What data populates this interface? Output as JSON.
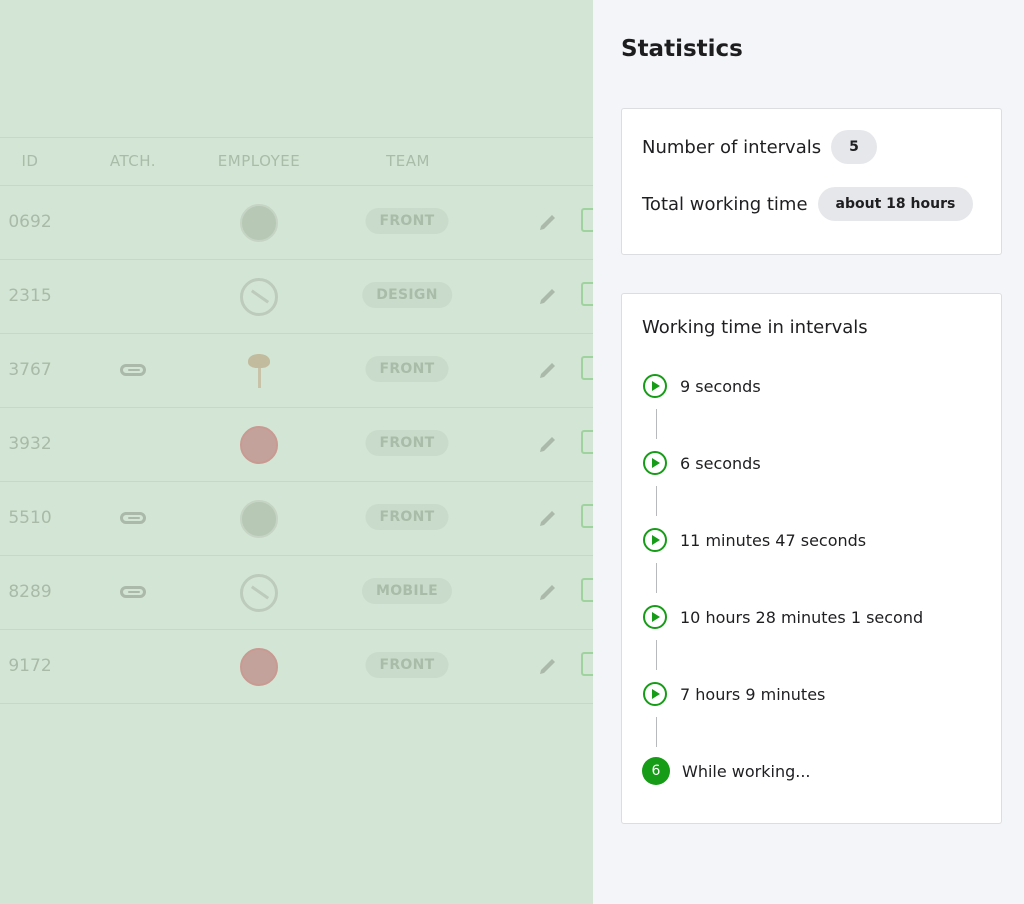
{
  "table": {
    "headers": [
      "ID",
      "ATCH.",
      "EMPLOYEE",
      "TEAM"
    ],
    "rows": [
      {
        "id": "0692",
        "attachment": false,
        "avatar": "photo",
        "team": "FRONT"
      },
      {
        "id": "2315",
        "attachment": false,
        "avatar": "no-image",
        "team": "DESIGN"
      },
      {
        "id": "3767",
        "attachment": true,
        "avatar": "pin",
        "team": "FRONT"
      },
      {
        "id": "3932",
        "attachment": false,
        "avatar": "rose",
        "team": "FRONT"
      },
      {
        "id": "5510",
        "attachment": true,
        "avatar": "photo",
        "team": "FRONT"
      },
      {
        "id": "8289",
        "attachment": true,
        "avatar": "no-image",
        "team": "MOBILE"
      },
      {
        "id": "9172",
        "attachment": false,
        "avatar": "rose",
        "team": "FRONT"
      }
    ]
  },
  "statistics": {
    "title": "Statistics",
    "intervals_label": "Number of intervals",
    "intervals_value": "5",
    "total_label": "Total working time",
    "total_value": "about 18 hours",
    "working_title": "Working time in intervals",
    "intervals": [
      "9 seconds",
      "6 seconds",
      "11 minutes 47 seconds",
      "10 hours 28 minutes 1 second",
      "7 hours 9 minutes"
    ],
    "current_index": "6",
    "current_label": "While working..."
  },
  "colors": {
    "accent": "#179c17",
    "overlay": "#d3e5d4"
  },
  "icons": [
    "paperclip-icon",
    "pencil-icon",
    "copy-icon",
    "play-circle-icon"
  ]
}
